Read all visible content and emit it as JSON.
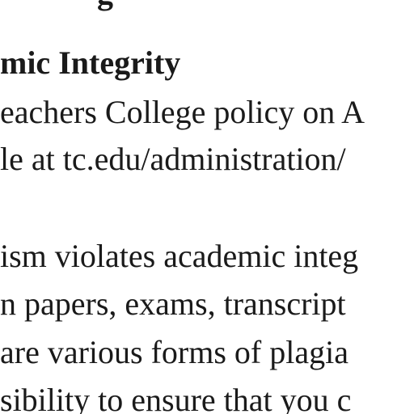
{
  "document": {
    "top_fragment": "g",
    "heading": "mic Integrity",
    "paragraph1": [
      "eachers College policy on A",
      "le at tc.edu/administration/"
    ],
    "paragraph2": [
      "ism violates academic integ",
      "n papers, exams, transcript",
      "are various forms of plagia",
      "sibility to ensure that you c"
    ]
  }
}
